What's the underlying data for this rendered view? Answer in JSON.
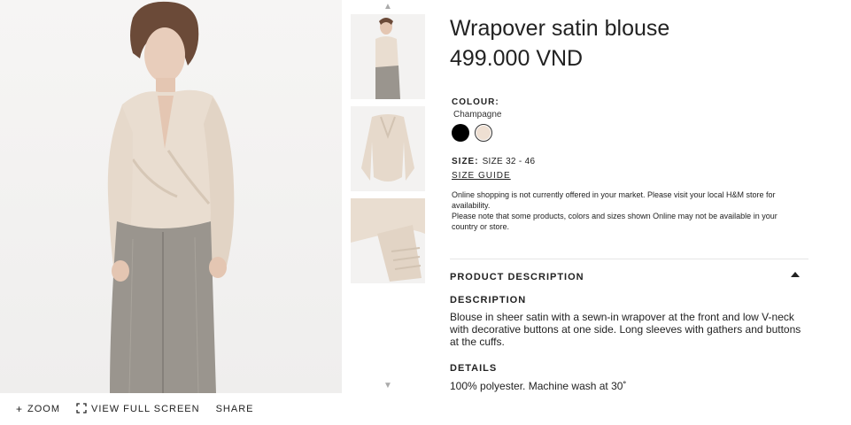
{
  "product": {
    "title": "Wrapover satin blouse",
    "price": "499.000 VND"
  },
  "colour": {
    "label": "COLOUR:",
    "selected": "Champagne",
    "swatches": [
      {
        "name": "black",
        "hex": "#000000"
      },
      {
        "name": "champagne",
        "hex": "#eedfd2"
      }
    ]
  },
  "size": {
    "label": "SIZE:",
    "value": "SIZE 32 - 46",
    "guide_link": "SIZE GUIDE"
  },
  "notice": {
    "line1": "Online shopping is not currently offered in your market. Please visit your local H&M store for availability.",
    "line2": "Please note that some products, colors and sizes shown Online may not be available in your country or store."
  },
  "product_description": {
    "header": "PRODUCT DESCRIPTION",
    "description_label": "DESCRIPTION",
    "description_text": "Blouse in sheer satin with a sewn-in wrapover at the front and low V-neck with decorative buttons at one side. Long sleeves with gathers and buttons at the cuffs.",
    "details_label": "DETAILS",
    "details_text": "100% polyester. Machine wash at 30˚"
  },
  "image_toolbar": {
    "zoom": "ZOOM",
    "fullscreen": "VIEW FULL SCREEN",
    "share": "SHARE",
    "zoom_icon": "plus-icon",
    "fullscreen_icon": "expand-icon"
  },
  "colors": {
    "text": "#222222",
    "blouse": "#e9ddd0",
    "trousers": "#9a958e"
  }
}
